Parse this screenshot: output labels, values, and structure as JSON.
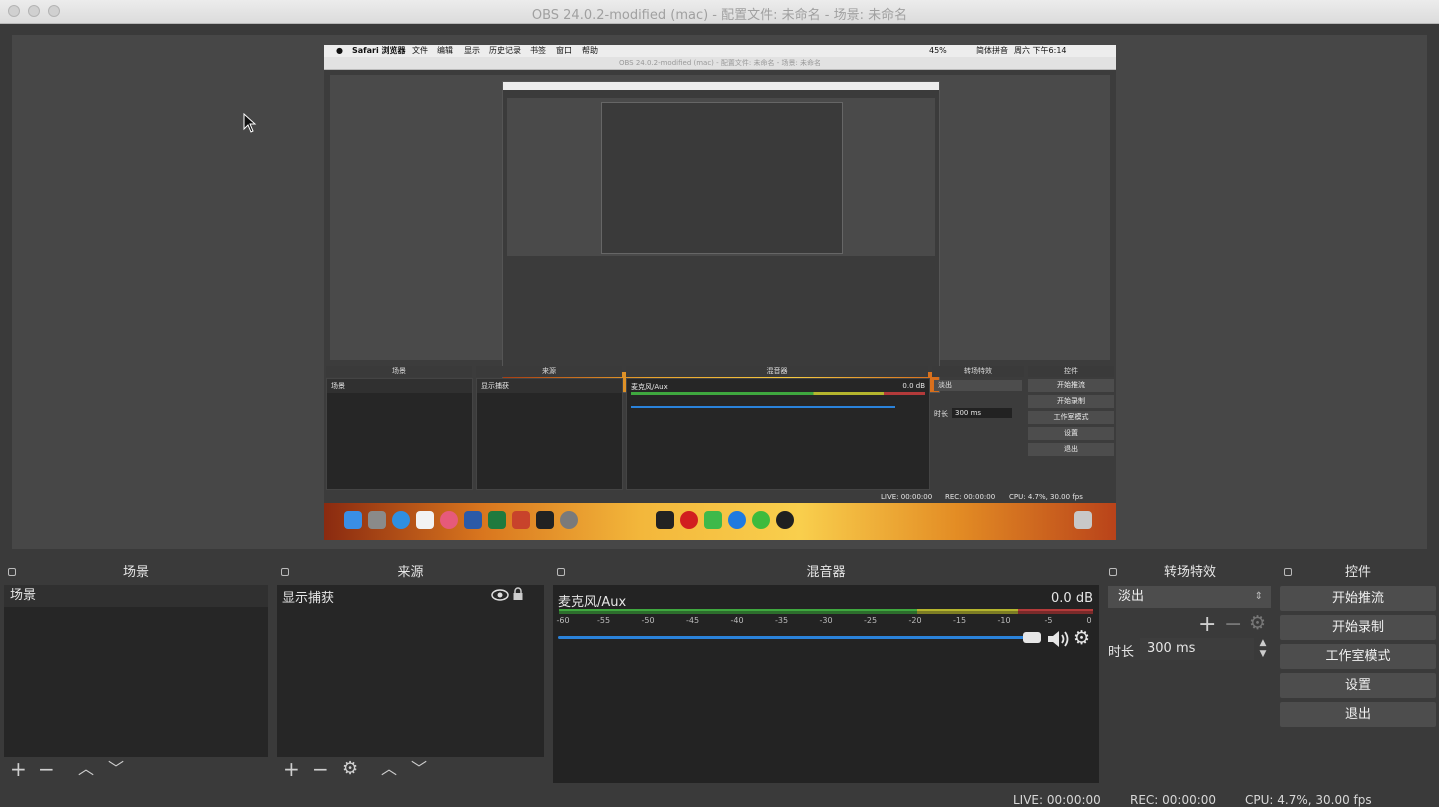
{
  "window": {
    "title": "OBS 24.0.2-modified (mac) - 配置文件: 未命名 - 场景: 未命名"
  },
  "capture": {
    "menubar": {
      "app": "Safari 浏览器",
      "items": [
        "文件",
        "编辑",
        "显示",
        "历史记录",
        "书签",
        "窗口",
        "帮助"
      ],
      "battery": "45%",
      "input_method": "简体拼音",
      "clock": "周六 下午6:14"
    },
    "title": "OBS 24.0.2-modified (mac) - 配置文件: 未命名 - 场景: 未命名",
    "docks": {
      "scenes": "场景",
      "sources": "来源",
      "mixer": "混音器",
      "transitions": "转场特效",
      "controls": "控件"
    },
    "scene_item": "场景",
    "source_item": "显示捕获",
    "mixer_channel": "麦克风/Aux",
    "mixer_db": "0.0 dB",
    "transition": "淡出",
    "duration_label": "时长",
    "duration_value": "300 ms",
    "buttons": [
      "开始推流",
      "开始录制",
      "工作室模式",
      "设置",
      "退出"
    ],
    "status": {
      "live": "LIVE: 00:00:00",
      "rec": "REC: 00:00:00",
      "cpu": "CPU: 4.7%, 30.00 fps"
    }
  },
  "docks": {
    "scenes": {
      "title": "场景",
      "items": [
        "场景"
      ]
    },
    "sources": {
      "title": "来源",
      "items": [
        "显示捕获"
      ]
    },
    "mixer": {
      "title": "混音器",
      "channel": "麦克风/Aux",
      "db": "0.0 dB",
      "ticks": [
        "-60",
        "-55",
        "-50",
        "-45",
        "-40",
        "-35",
        "-30",
        "-25",
        "-20",
        "-15",
        "-10",
        "-5",
        "0"
      ],
      "volume_fraction": 1.0
    },
    "transitions": {
      "title": "转场特效",
      "selected": "淡出",
      "duration_label": "时长",
      "duration_value": "300 ms"
    },
    "controls": {
      "title": "控件",
      "start_stream": "开始推流",
      "start_record": "开始录制",
      "studio_mode": "工作室模式",
      "settings": "设置",
      "exit": "退出"
    }
  },
  "status": {
    "live": "LIVE: 00:00:00",
    "rec": "REC: 00:00:00",
    "cpu": "CPU: 4.7%, 30.00 fps"
  },
  "colors": {
    "accent": "#2a82da",
    "meter_green": "#3fa83f",
    "meter_yellow": "#b5b52e",
    "meter_red": "#b33a3a"
  }
}
